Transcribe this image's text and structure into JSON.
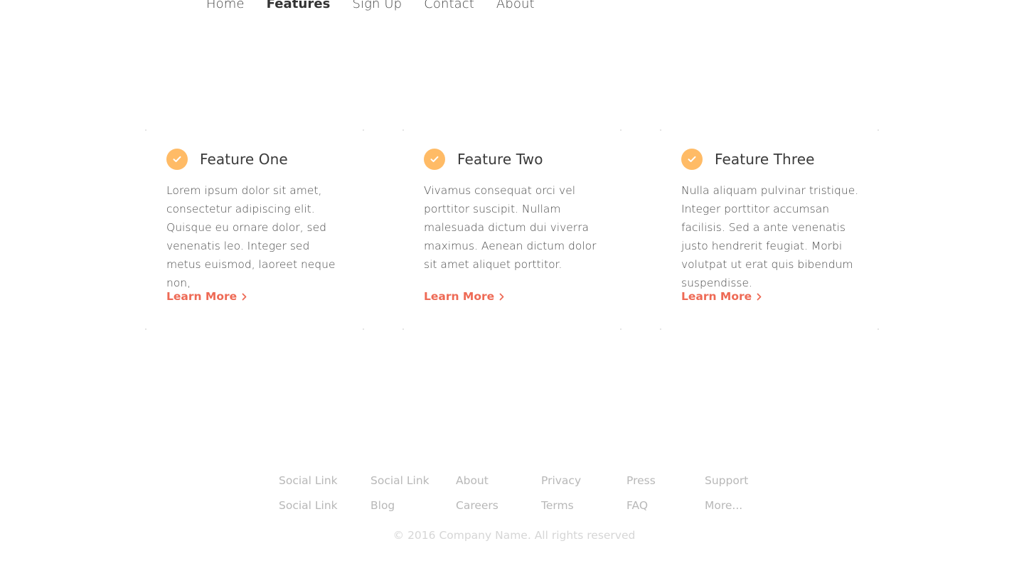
{
  "nav": {
    "items": [
      {
        "label": "Home",
        "active": false
      },
      {
        "label": "Features",
        "active": true
      },
      {
        "label": "Sign Up",
        "active": false
      },
      {
        "label": "Contact",
        "active": false
      },
      {
        "label": "About",
        "active": false
      }
    ]
  },
  "features": [
    {
      "title": "Feature One",
      "body": "Lorem ipsum dolor sit amet, consectetur adipiscing elit. Quisque eu ornare dolor, sed venenatis leo. Integer sed metus euismod, laoreet neque non,",
      "link": "Learn More",
      "icon": "check-icon"
    },
    {
      "title": "Feature Two",
      "body": "Vivamus consequat orci vel porttitor suscipit. Nullam malesuada dictum dui viverra maximus. Aenean dictum dolor sit amet aliquet porttitor.",
      "link": "Learn More",
      "icon": "check-icon"
    },
    {
      "title": "Feature Three",
      "body": "Nulla aliquam pulvinar tristique. Integer porttitor accumsan facilisis. Sed a ante venenatis justo hendrerit feugiat. Morbi volutpat ut erat quis bibendum suspendisse.",
      "link": "Learn More",
      "icon": "check-icon"
    }
  ],
  "footer": {
    "columns": [
      [
        "Social Link",
        "Social Link"
      ],
      [
        "Social Link",
        "Blog"
      ],
      [
        "About",
        "Careers"
      ],
      [
        "Privacy",
        "Terms"
      ],
      [
        "Press",
        "FAQ"
      ],
      [
        "Support",
        "More..."
      ]
    ],
    "copyright": "© 2016 Company Name. All rights reserved"
  },
  "colors": {
    "accent_icon": "#ffbb66",
    "link": "#ee6a55",
    "footer_text": "#b8b8b8"
  }
}
